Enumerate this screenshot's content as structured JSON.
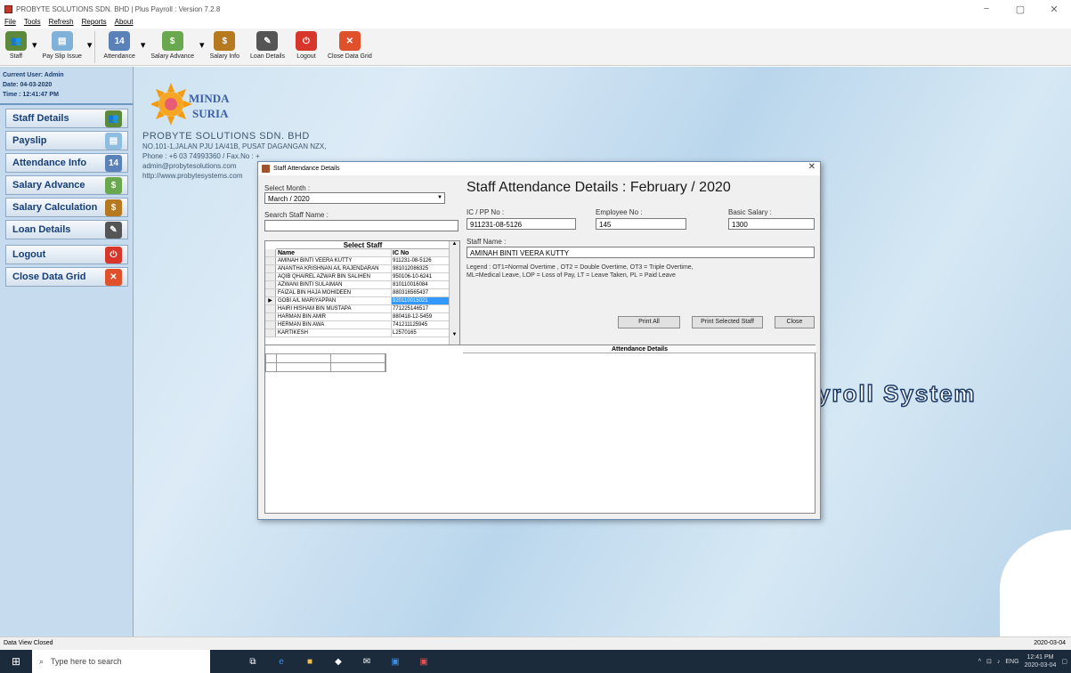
{
  "window": {
    "title": "PROBYTE SOLUTIONS SDN. BHD | Plus Payroll : Version 7.2.8",
    "controls": [
      "−",
      "▢",
      "✕"
    ]
  },
  "menu": [
    "File",
    "Tools",
    "Refresh",
    "Reports",
    "About"
  ],
  "toolbar": [
    {
      "label": "Staff",
      "icon": "staff-icon",
      "color": "#5c8a3a",
      "dropdown": true
    },
    {
      "label": "Pay Slip Issue",
      "icon": "payslip-icon",
      "color": "#7fb1d9",
      "dropdown": true
    },
    {
      "label": "Attendance",
      "icon": "calendar-icon",
      "color": "#5b82b8",
      "dropdown": true
    },
    {
      "label": "Salary Advance",
      "icon": "money-icon",
      "color": "#6aa84f",
      "dropdown": true
    },
    {
      "label": "Salary Info",
      "icon": "moneybag-icon",
      "color": "#b7791f",
      "dropdown": false
    },
    {
      "label": "Loan Details",
      "icon": "loan-icon",
      "color": "#555",
      "dropdown": false
    },
    {
      "label": "Logout",
      "icon": "power-icon",
      "color": "#d9362b",
      "dropdown": false
    },
    {
      "label": "Close Data Grid",
      "icon": "close-icon",
      "color": "#e0502a",
      "dropdown": false
    }
  ],
  "leftinfo": {
    "user": "Current User: Admin",
    "date": "Date: 04-03-2020",
    "time": "Time : 12:41:47 PM"
  },
  "nav": [
    {
      "label": "Staff Details",
      "icon": "staff-icon",
      "color": "#5c8a3a"
    },
    {
      "label": "Payslip",
      "icon": "payslip-icon",
      "color": "#8fbde0"
    },
    {
      "label": "Attendance Info",
      "icon": "calendar-icon",
      "color": "#5b82b8"
    },
    {
      "label": "Salary Advance",
      "icon": "money-icon",
      "color": "#6aa84f"
    },
    {
      "label": "Salary Calculation",
      "icon": "moneybag-icon",
      "color": "#b7791f"
    },
    {
      "label": "Loan Details",
      "icon": "loan-icon",
      "color": "#555"
    },
    {
      "label": "Logout",
      "icon": "power-icon",
      "color": "#d9362b"
    },
    {
      "label": "Close Data Grid",
      "icon": "close-icon",
      "color": "#e0502a"
    }
  ],
  "logo": {
    "line1": "MINDA",
    "line2": "SURIA"
  },
  "company": {
    "name": "PROBYTE SOLUTIONS  SDN. BHD",
    "address": "NO.101-1,JALAN PJU 1A/41B, PUSAT DAGANGAN NZX,",
    "phone": "Phone : +6 03 74993360 / Fax.No : +",
    "email": "admin@probytesolutions.com",
    "web": "http://www.probytesystems.com"
  },
  "background_title": "yroll  System",
  "dialog": {
    "title": "Staff Attendance Details",
    "select_month_label": "Select Month :",
    "select_month_value": "March / 2020",
    "search_label": "Search Staff Name :",
    "search_value": "",
    "grid_caption": "Select Staff",
    "grid_headers": [
      "Name",
      "IC No"
    ],
    "staff": [
      {
        "name": "AMINAH BINTI VEERA KUTTY",
        "ic": "911231-08-5126"
      },
      {
        "name": "ANANTHA KRISHNAN A/L RAJENDARAN",
        "ic": "981012086325"
      },
      {
        "name": "AQIB QHAIREL AZWAR BIN SALIHEN",
        "ic": "950106-10-6241"
      },
      {
        "name": "AZWANI BINTI SULAIMAN",
        "ic": "810110016084"
      },
      {
        "name": "FAIZAL BIN HAJA MOHIDEEN",
        "ic": "880316565437"
      },
      {
        "name": "GOBI A/L MARIYAPPAN",
        "ic": "920110015021",
        "selected": true
      },
      {
        "name": "HAIRI HISHAM BIN MUSTAPA",
        "ic": "771225146517"
      },
      {
        "name": "HARMAN BIN AMIR",
        "ic": "880418-12-5459"
      },
      {
        "name": "HERMAN BIN AWA",
        "ic": "741211125945"
      },
      {
        "name": "KARTIKESH",
        "ic": "L2570165"
      }
    ],
    "headline": "Staff Attendance Details  :   February / 2020",
    "ic_label": "IC / PP No :",
    "ic_value": "911231-08-5126",
    "emp_label": "Employee No :",
    "emp_value": "145",
    "salary_label": "Basic Salary :",
    "salary_value": "1300",
    "name_label": "Staff Name :",
    "name_value": "AMINAH BINTI VEERA KUTTY",
    "legend1": "Legend : OT1=Normal Overtime , OT2 = Double Overtime,  OT3 = Triple Overtime,",
    "legend2": "ML=Medical Leave,  LOP = Loss of Pay,  LT = Leave Taken,  PL = Paid Leave",
    "btn_print_all": "Print All",
    "btn_print_selected": "Print Selected Staff",
    "btn_close": "Close",
    "attendance_caption": "Attendance Details"
  },
  "status": {
    "left": "Data View Closed",
    "right": "2020-03-04"
  },
  "taskbar": {
    "search": "Type here to search",
    "time": "12:41 PM",
    "date": "2020-03-04",
    "lang": "ENG"
  }
}
